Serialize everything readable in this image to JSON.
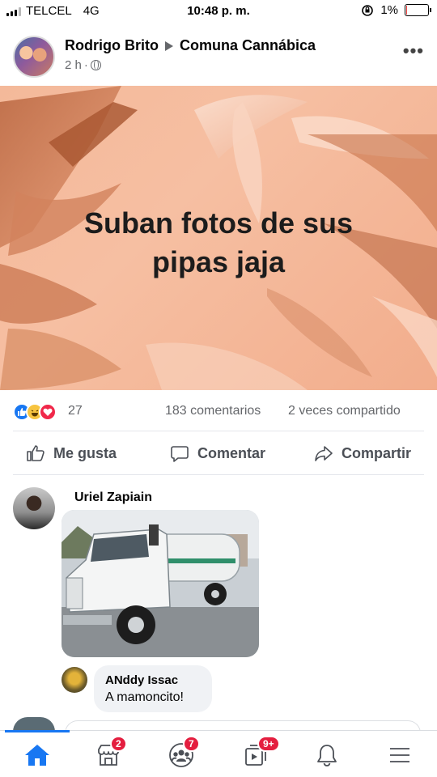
{
  "status_bar": {
    "carrier": "TELCEL",
    "network": "4G",
    "time": "10:48 p. m.",
    "battery": "1%",
    "battery_level": 0.01
  },
  "post": {
    "author": "Rodrigo Brito",
    "group": "Comuna Cannábica",
    "time": "2 h",
    "separator": "·",
    "banner_text": "Suban fotos de sus pipas jaja",
    "banner_colors": {
      "background": "#f4b99a",
      "leaf_dark": "#c8734a",
      "leaf_light": "#f9d3bf",
      "text": "#1c1c1c"
    },
    "reaction_count": "27",
    "comments": "183 comentarios",
    "shares": "2 veces compartido",
    "actions": {
      "like": "Me gusta",
      "comment": "Comentar",
      "share": "Compartir"
    }
  },
  "comments": [
    {
      "author": "Uriel Zapiain",
      "photo": "white-tanker-truck",
      "replies": [
        {
          "author": "ANddy Issac",
          "text": "A mamoncito!"
        }
      ]
    }
  ],
  "tab_bar": {
    "tabs": [
      {
        "name": "home-icon",
        "badge": ""
      },
      {
        "name": "marketplace-icon",
        "badge": "2"
      },
      {
        "name": "groups-icon",
        "badge": "7"
      },
      {
        "name": "watch-icon",
        "badge": "9+"
      },
      {
        "name": "bell-icon",
        "badge": ""
      },
      {
        "name": "menu-icon",
        "badge": ""
      }
    ],
    "active_color": "#1877f2",
    "badge_color": "#e41e3f"
  }
}
